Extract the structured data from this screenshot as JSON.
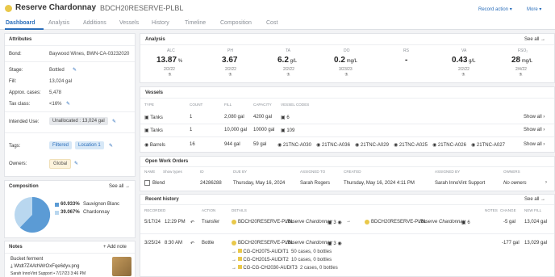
{
  "header": {
    "title": "Reserve Chardonnay",
    "code": "BDCH20RESERVE-PLBL",
    "record_action": "Record action",
    "more": "More"
  },
  "tabs": [
    "Dashboard",
    "Analysis",
    "Additions",
    "Vessels",
    "History",
    "Timeline",
    "Composition",
    "Cost"
  ],
  "attributes": {
    "title": "Attributes",
    "bond_label": "Bond:",
    "bond_value": "Baywood Wines, BWN-CA-03232020",
    "stage_label": "Stage:",
    "stage_value": "Bottled",
    "fill_label": "Fill:",
    "fill_value": "13,024 gal",
    "cases_label": "Approx. cases:",
    "cases_value": "5,478",
    "tax_label": "Tax class:",
    "tax_value": "<16%",
    "intended_label": "Intended Use:",
    "intended_value": "Unallocated : 13,024 gal",
    "tags_label": "Tags:",
    "tag1": "Filtered",
    "tag2": "Location 1",
    "owners_label": "Owners:",
    "owner1": "Global"
  },
  "composition": {
    "title": "Composition",
    "see_all": "See all",
    "items": [
      {
        "pct": "60.933%",
        "name": "Sauvignon Blanc"
      },
      {
        "pct": "39.067%",
        "name": "Chardonnay"
      }
    ],
    "colors": [
      "#5b9bd5",
      "#b9d7ef"
    ]
  },
  "notes": {
    "title": "Notes",
    "add": "Add note",
    "note_title": "Bucket ferment",
    "note_link": "Wtdt7Z4AthWrOxFqe6dyv.png",
    "note_meta": "Sarah InnoVint Support • 7/17/23 3:46 PM"
  },
  "analysis": {
    "title": "Analysis",
    "see_all": "See all",
    "metrics": [
      {
        "name": "ALC",
        "value": "13.87",
        "unit": "%",
        "date": "2/2/22"
      },
      {
        "name": "PH",
        "value": "3.67",
        "unit": "",
        "date": "2/2/22"
      },
      {
        "name": "TA",
        "value": "6.2",
        "unit": "g/L",
        "date": "2/2/22"
      },
      {
        "name": "DO",
        "value": "0.2",
        "unit": "mg/L",
        "date": "3/23/23"
      },
      {
        "name": "RS",
        "value": "-",
        "unit": "",
        "date": ""
      },
      {
        "name": "VA",
        "value": "0.43",
        "unit": "g/L",
        "date": "2/2/22"
      },
      {
        "name": "FSO₂",
        "value": "28",
        "unit": "mg/L",
        "date": "2/4/22"
      }
    ]
  },
  "vessels": {
    "title": "Vessels",
    "columns": [
      "TYPE",
      "COUNT",
      "FILL",
      "CAPACITY",
      "VESSEL CODES"
    ],
    "show_all": "Show all",
    "rows": [
      {
        "type": "Tanks",
        "count": "1",
        "fill": "2,080 gal",
        "capacity": "4200 gal",
        "codes": [
          "6"
        ]
      },
      {
        "type": "Tanks",
        "count": "1",
        "fill": "10,000 gal",
        "capacity": "10000 gal",
        "codes": [
          "109"
        ]
      },
      {
        "type": "Barrels",
        "count": "16",
        "fill": "944 gal",
        "capacity": "59 gal",
        "codes": [
          "21TNC-A030",
          "21TNC-A036",
          "21TNC-A029",
          "21TNC-A025",
          "21TNC-A026",
          "21TNC-A027"
        ]
      }
    ]
  },
  "work_orders": {
    "title": "Open Work Orders",
    "columns": {
      "name": "NAME",
      "show_types": "Show types",
      "id": "ID",
      "due": "DUE BY",
      "assigned_to": "ASSIGNED TO",
      "created": "CREATED",
      "assigned_by": "ASSIGNED BY",
      "owners": "OWNERS"
    },
    "row": {
      "name": "Blend",
      "id": "24286288",
      "due": "Thursday, May 16, 2024",
      "assigned_to": "Sarah Rogers",
      "created": "Thursday, May 16, 2024 4:11 PM",
      "assigned_by": "Sarah InnoVint Support",
      "owners": "No owners"
    }
  },
  "history": {
    "title": "Recent history",
    "see_all": "See all",
    "columns": [
      "RECORDED",
      "ACTION",
      "DETAILS",
      "NOTES",
      "CHANGE",
      "NEW FILL"
    ],
    "rows": [
      {
        "date": "5/17/24",
        "time": "12:29 PM",
        "action": "Transfer",
        "lot": "BDCH20RESERVE-PLBL",
        "variety": "Reserve Chardonnay",
        "n1": "3",
        "lot2": "BDCH20RESERVE-PLBL",
        "variety2": "Reserve Chardonnay",
        "vessel": "6",
        "change": "-5 gal",
        "new_fill": "13,024 gal"
      },
      {
        "date": "3/25/24",
        "time": "8:30 AM",
        "action": "Bottle",
        "lot": "BDCH20RESERVE-PLBL",
        "variety": "Reserve Chardonnay",
        "n1": "3",
        "change": "-177 gal",
        "new_fill": "13,029 gal",
        "subs": [
          {
            "code": "CG-CH2075-AUDIT1",
            "qty": "50 cases, 0 bottles"
          },
          {
            "code": "CG-CH2015-AUDIT2",
            "qty": "10 cases, 0 bottles"
          },
          {
            "code": "CG-CG-CH2030-AUDIT3",
            "qty": "2 cases, 0 bottles"
          }
        ]
      }
    ]
  }
}
